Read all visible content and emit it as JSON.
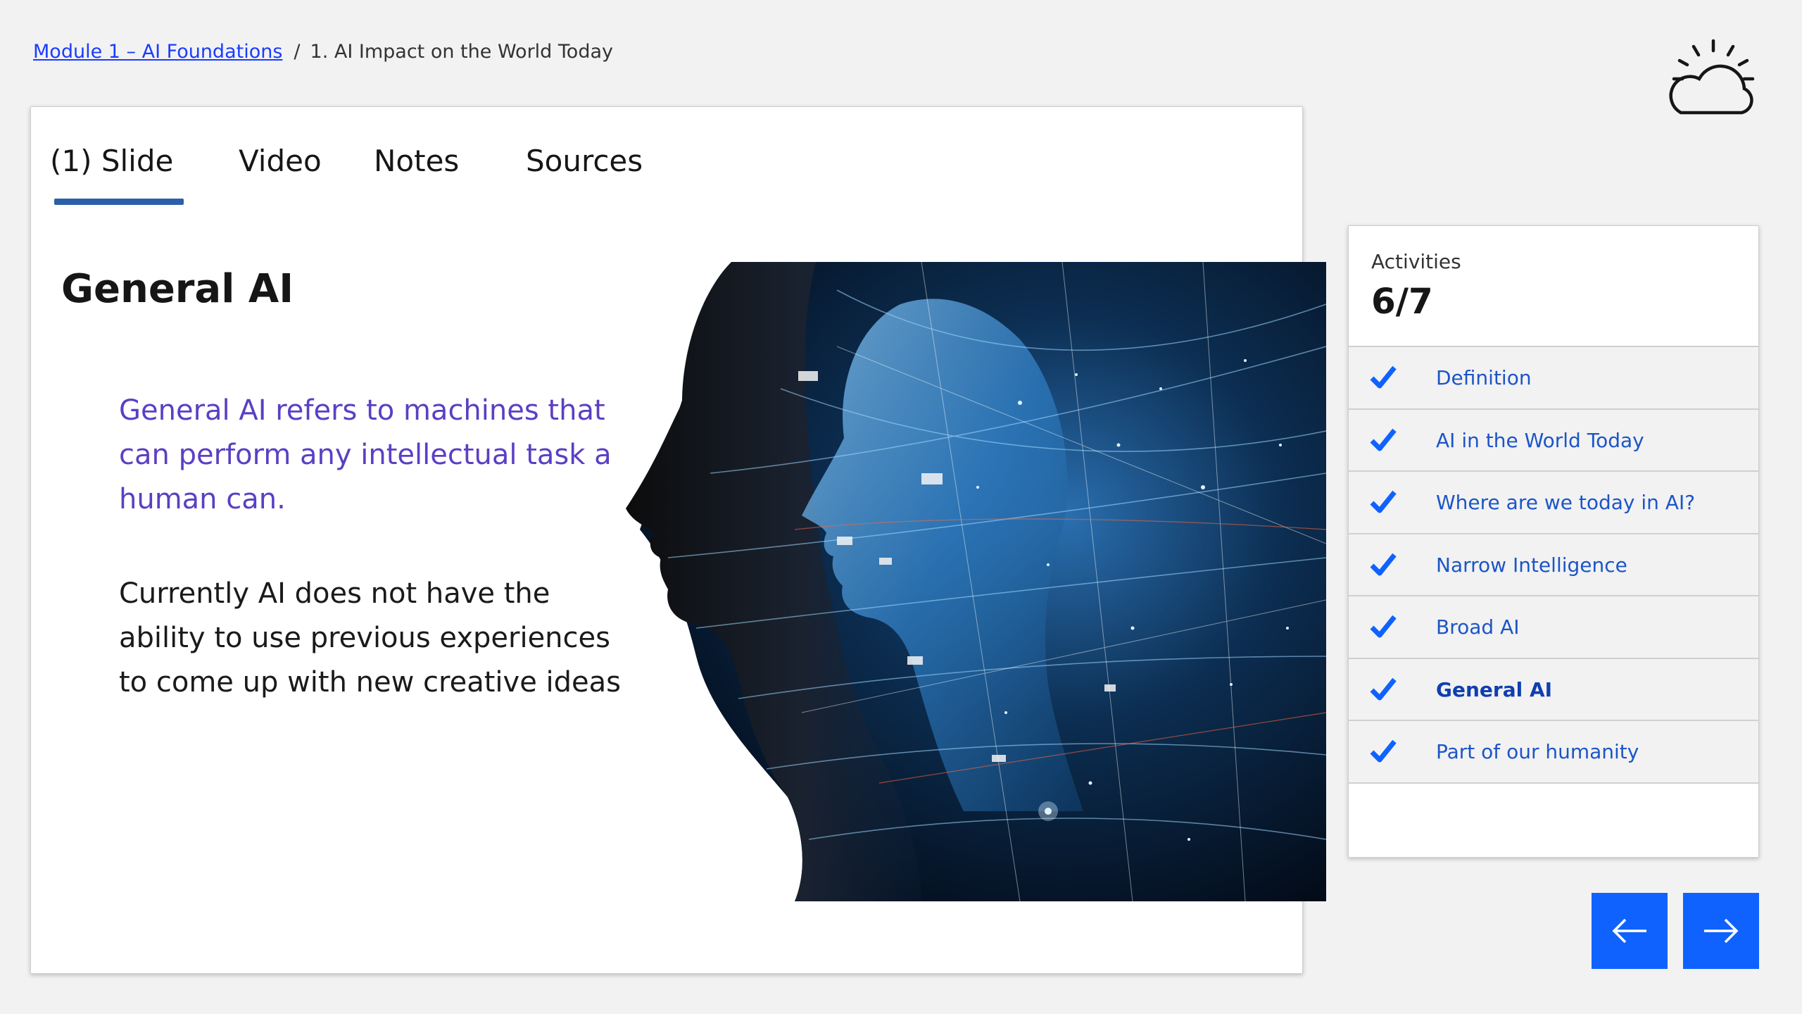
{
  "breadcrumb": {
    "module_link": "Module 1 – AI Foundations",
    "separator": "/",
    "current": "1. AI Impact on the World Today"
  },
  "logo": {
    "icon": "sun-cloud-icon"
  },
  "tabs": [
    {
      "label": "(1) Slide",
      "active": true
    },
    {
      "label": "Video",
      "active": false
    },
    {
      "label": "Notes",
      "active": false
    },
    {
      "label": "Sources",
      "active": false
    }
  ],
  "slide": {
    "title": "General AI",
    "paragraph1": "General AI refers to machines that can perform any intellectual task a human can.",
    "paragraph2": "Currently AI does not have the ability to use previous experiences to come up with new creative ideas",
    "image": "ai-human-profile-network-image"
  },
  "activities": {
    "label": "Activities",
    "count": "6/7",
    "items": [
      {
        "label": "Definition",
        "completed": true,
        "active": false
      },
      {
        "label": "AI in the World Today",
        "completed": true,
        "active": false
      },
      {
        "label": "Where are we today in AI?",
        "completed": true,
        "active": false
      },
      {
        "label": "Narrow Intelligence",
        "completed": true,
        "active": false
      },
      {
        "label": "Broad AI",
        "completed": true,
        "active": false
      },
      {
        "label": "General AI",
        "completed": true,
        "active": true
      },
      {
        "label": "Part of our humanity",
        "completed": true,
        "active": false
      }
    ]
  },
  "nav": {
    "prev_icon": "arrow-left-icon",
    "next_icon": "arrow-right-icon"
  },
  "colors": {
    "accent": "#0f62fe",
    "tab_underline": "#2d5fa8",
    "purple_text": "#5b3fc4",
    "link": "#1c55c7",
    "check": "#0f62fe"
  }
}
